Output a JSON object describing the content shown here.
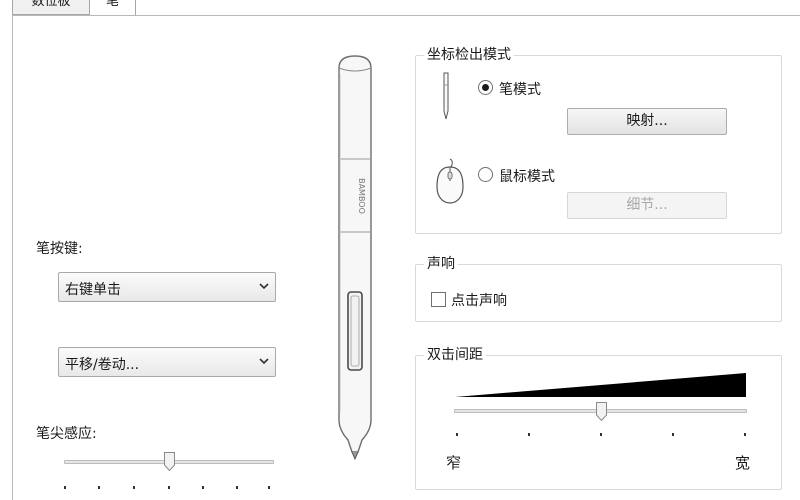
{
  "tabs": [
    {
      "label": "数位板",
      "active": false
    },
    {
      "label": "笔",
      "active": true
    }
  ],
  "pen_buttons": {
    "label": "笔按键:",
    "upper_value": "右键单击",
    "lower_value": "平移/卷动..."
  },
  "tip_feel": {
    "label": "笔尖感应:"
  },
  "pen_image": {
    "brand": "BAMBOO"
  },
  "tracking_mode": {
    "title": "坐标检出模式",
    "pen_mode_label": "笔模式",
    "pen_mode_selected": true,
    "mapping_button": "映射...",
    "mouse_mode_label": "鼠标模式",
    "mouse_mode_selected": false,
    "details_button": "细节..."
  },
  "sound": {
    "title": "声响",
    "click_sound_label": "点击声响",
    "click_sound_checked": false
  },
  "double_click_distance": {
    "title": "双击间距",
    "min_label": "窄",
    "max_label": "宽"
  }
}
